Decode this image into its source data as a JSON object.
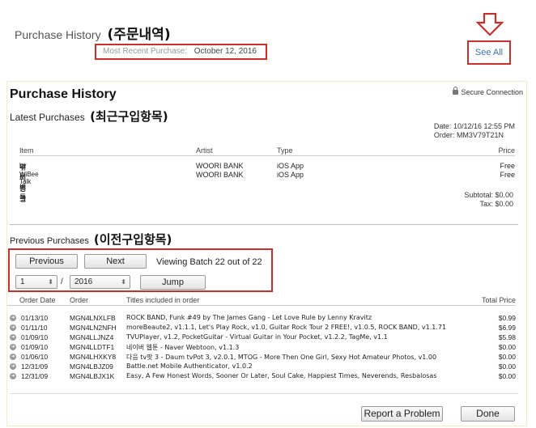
{
  "header": {
    "title": "Purchase History",
    "title_korean": "(주문내역)",
    "recent_label": "Most Recent Purchase:",
    "recent_date": "October 12, 2016",
    "see_all": "See All"
  },
  "receipt": {
    "title": "Purchase History",
    "secure": "Secure Connection",
    "latest_label": "Latest Purchases",
    "latest_label_korean": "(최근구입항목)",
    "date_label": "Date:",
    "date_value": "10/12/16 12:55 PM",
    "order_label": "Order:",
    "order_value": "MM3V79T21N",
    "columns": {
      "item": "Item",
      "artist": "Artist",
      "type": "Type",
      "price": "Price"
    },
    "items": [
      {
        "name": "위비뱅크",
        "by": "by",
        "developer": "우리은행",
        "artist": "WOORI BANK",
        "type": "iOS App",
        "price": "Free"
      },
      {
        "name": "위비톡",
        "by": "",
        "developer": "WiBee Talk",
        "artist": "WOORI BANK",
        "type": "iOS App",
        "price": "Free"
      }
    ],
    "subtotal_label": "Subtotal:",
    "subtotal_value": "$0.00",
    "tax_label": "Tax:",
    "tax_value": "$0.00"
  },
  "previous": {
    "label": "Previous Purchases",
    "label_korean": "(이전구입항목)",
    "prev_button": "Previous",
    "next_button": "Next",
    "batch_text": "Viewing Batch 22 out of 22",
    "month_value": "1",
    "year_value": "2016",
    "slash": "/",
    "jump_button": "Jump",
    "columns": {
      "order_date": "Order Date",
      "order": "Order",
      "titles": "Titles included in order",
      "total": "Total Price"
    },
    "rows": [
      {
        "date": "01/13/10",
        "order": "MGN4LNXLFB",
        "titles": "ROCK BAND, Funk #49 by The James Gang - Let Love Rule by Lenny Kravitz",
        "total": "$0.99"
      },
      {
        "date": "01/11/10",
        "order": "MGN4LN2NFH",
        "titles": "moreBeaute2, v1.1.1, Let's Play Rock, v1.0, Guitar Rock Tour 2 FREE!, v1.0.5, ROCK BAND, v1.1.71",
        "total": "$6.99"
      },
      {
        "date": "01/09/10",
        "order": "MGN4LLJNZ4",
        "titles": "TVUPlayer, v1.2, PocketGuitar - Virtual Guitar in Your Pocket, v1.2.2, TagMe, v1.1",
        "total": "$5.98"
      },
      {
        "date": "01/09/10",
        "order": "MGN4LLDTF1",
        "titles": "네이버 웹툰 - Naver Webtoon, v1.1.3",
        "total": "$0.00"
      },
      {
        "date": "01/06/10",
        "order": "MGN4LHXKY8",
        "titles": "다음 tv팟 3 - Daum tvPot 3, v2.0.1, MTOG - More Then One Girl, Sexy Hot Amateur Photos, v1.00",
        "total": "$0.00"
      },
      {
        "date": "12/31/09",
        "order": "MGN4LBJZ09",
        "titles": "Battle.net Mobile Authenticator, v1.0.2",
        "total": "$0.00"
      },
      {
        "date": "12/31/09",
        "order": "MGN4LBJX1K",
        "titles": "Easy, A Few Honest Words, Sooner Or Later, Soul Cake, Happiest Times, Neverends, Resbalosas",
        "total": "$0.00"
      }
    ]
  },
  "footer": {
    "report_button": "Report a Problem",
    "done_button": "Done"
  },
  "colors": {
    "highlight_red": "#c9302c",
    "link_blue": "#3a72b5"
  }
}
